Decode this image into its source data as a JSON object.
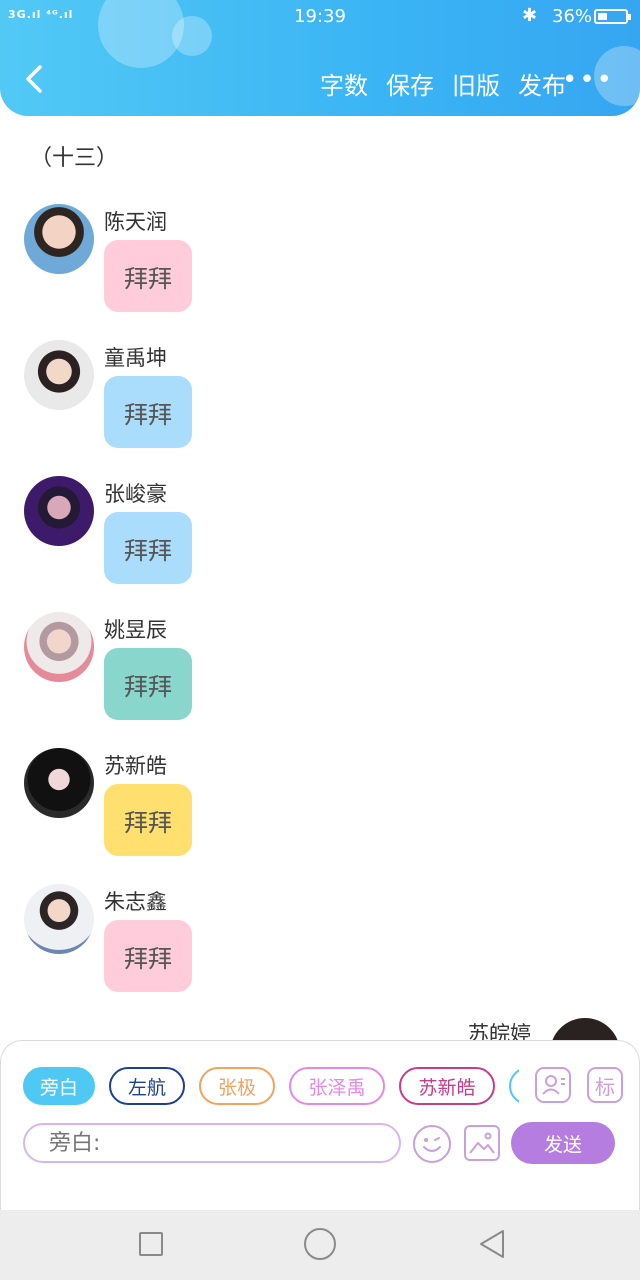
{
  "status_bar": {
    "signal": "3G.ıl ⁴ᴳ.ıl",
    "time": "19:39",
    "battery": "36%",
    "battery_level": 0.36
  },
  "toolbar": {
    "word_count": "字数",
    "save": "保存",
    "old_version": "旧版",
    "publish": "发布",
    "more": "•••"
  },
  "chapter_title": "（十三）",
  "messages": [
    {
      "name": "陈天润",
      "text": "拜拜",
      "color": "#ffccdc"
    },
    {
      "name": "童禹坤",
      "text": "拜拜",
      "color": "#aadcfb"
    },
    {
      "name": "张峻豪",
      "text": "拜拜",
      "color": "#aadcfb"
    },
    {
      "name": "姚昱辰",
      "text": "拜拜",
      "color": "#88d6cc"
    },
    {
      "name": "苏新皓",
      "text": "拜拜",
      "color": "#ffe06e"
    },
    {
      "name": "朱志鑫",
      "text": "拜拜",
      "color": "#ffccdc"
    }
  ],
  "partial_message": {
    "name": "苏皖婷"
  },
  "composer": {
    "chips": [
      {
        "label": "旁白",
        "color": "#4fc8f3"
      },
      {
        "label": "左航",
        "color": "#1f3f8f"
      },
      {
        "label": "张极",
        "color": "#f4a260"
      },
      {
        "label": "张泽禹",
        "color": "#e38ae6"
      },
      {
        "label": "苏新皓",
        "color": "#c63d8a"
      }
    ],
    "tag_label": "标",
    "input_placeholder": "旁白:",
    "send_label": "发送"
  }
}
